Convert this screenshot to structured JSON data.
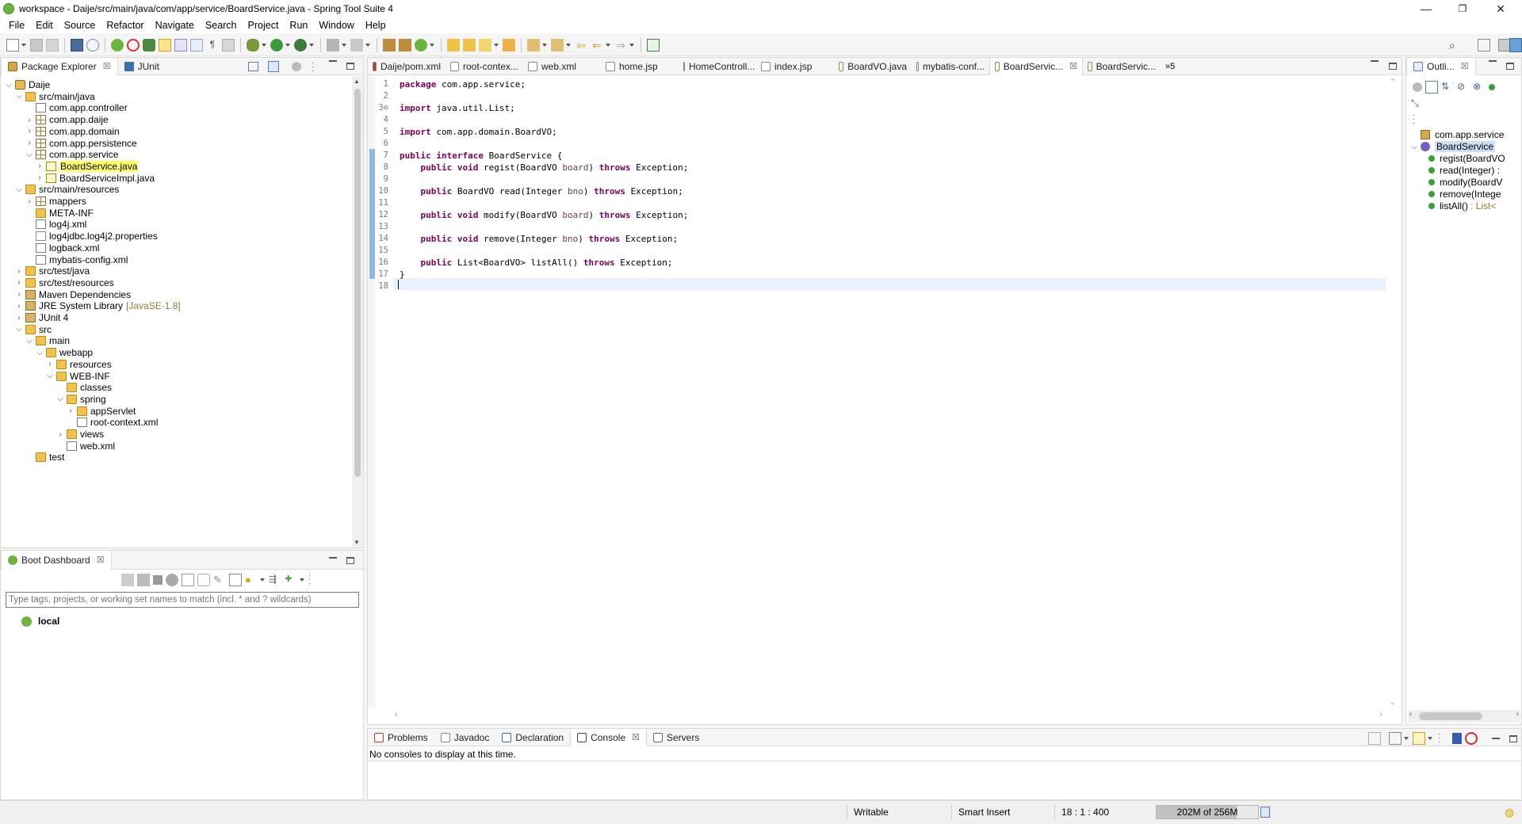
{
  "window": {
    "title": "workspace - Daije/src/main/java/com/app/service/BoardService.java - Spring Tool Suite 4",
    "minimize": "—",
    "restore": "❐",
    "close": "✕"
  },
  "menu": [
    "File",
    "Edit",
    "Source",
    "Refactor",
    "Navigate",
    "Search",
    "Project",
    "Run",
    "Window",
    "Help"
  ],
  "package_explorer": {
    "tabs": [
      {
        "label": "Package Explorer",
        "close": "☒"
      },
      {
        "label": "JUnit"
      }
    ],
    "tree": [
      {
        "label": "Daije",
        "level": 0,
        "twisty": "v",
        "icon": "project-icon"
      },
      {
        "label": "src/main/java",
        "level": 1,
        "twisty": "v",
        "icon": "source-folder-icon"
      },
      {
        "label": "com.app.controller",
        "level": 2,
        "twisty": "",
        "icon": "empty-package-icon"
      },
      {
        "label": "com.app.daije",
        "level": 2,
        "twisty": ">",
        "icon": "package-icon"
      },
      {
        "label": "com.app.domain",
        "level": 2,
        "twisty": ">",
        "icon": "package-icon"
      },
      {
        "label": "com.app.persistence",
        "level": 2,
        "twisty": ">",
        "icon": "package-icon"
      },
      {
        "label": "com.app.service",
        "level": 2,
        "twisty": "v",
        "icon": "package-icon"
      },
      {
        "label": "BoardService.java",
        "level": 3,
        "twisty": ">",
        "icon": "java-interface-file-icon",
        "selected": true
      },
      {
        "label": "BoardServiceImpl.java",
        "level": 3,
        "twisty": ">",
        "icon": "java-file-icon"
      },
      {
        "label": "src/main/resources",
        "level": 1,
        "twisty": "v",
        "icon": "source-folder-icon"
      },
      {
        "label": "mappers",
        "level": 2,
        "twisty": ">",
        "icon": "package-icon"
      },
      {
        "label": "META-INF",
        "level": 2,
        "twisty": "",
        "icon": "folder-icon"
      },
      {
        "label": "log4j.xml",
        "level": 2,
        "twisty": "",
        "icon": "xml-file-icon"
      },
      {
        "label": "log4jdbc.log4j2.properties",
        "level": 2,
        "twisty": "",
        "icon": "file-icon"
      },
      {
        "label": "logback.xml",
        "level": 2,
        "twisty": "",
        "icon": "xml-file-icon"
      },
      {
        "label": "mybatis-config.xml",
        "level": 2,
        "twisty": "",
        "icon": "xml-file-icon"
      },
      {
        "label": "src/test/java",
        "level": 1,
        "twisty": ">",
        "icon": "source-folder-icon"
      },
      {
        "label": "src/test/resources",
        "level": 1,
        "twisty": ">",
        "icon": "source-folder-icon"
      },
      {
        "label": "Maven Dependencies",
        "level": 1,
        "twisty": ">",
        "icon": "library-icon"
      },
      {
        "label": "JRE System Library",
        "deco": "[JavaSE-1.8]",
        "level": 1,
        "twisty": ">",
        "icon": "library-icon"
      },
      {
        "label": "JUnit 4",
        "level": 1,
        "twisty": ">",
        "icon": "library-icon"
      },
      {
        "label": "src",
        "level": 1,
        "twisty": "v",
        "icon": "folder-icon"
      },
      {
        "label": "main",
        "level": 2,
        "twisty": "v",
        "icon": "folder-icon"
      },
      {
        "label": "webapp",
        "level": 3,
        "twisty": "v",
        "icon": "folder-icon"
      },
      {
        "label": "resources",
        "level": 4,
        "twisty": ">",
        "icon": "folder-icon"
      },
      {
        "label": "WEB-INF",
        "level": 4,
        "twisty": "v",
        "icon": "folder-icon"
      },
      {
        "label": "classes",
        "level": 5,
        "twisty": "",
        "icon": "folder-icon"
      },
      {
        "label": "spring",
        "level": 5,
        "twisty": "v",
        "icon": "folder-icon"
      },
      {
        "label": "appServlet",
        "level": 6,
        "twisty": ">",
        "icon": "folder-icon"
      },
      {
        "label": "root-context.xml",
        "level": 6,
        "twisty": "",
        "icon": "xml-file-icon"
      },
      {
        "label": "views",
        "level": 5,
        "twisty": ">",
        "icon": "folder-icon"
      },
      {
        "label": "web.xml",
        "level": 5,
        "twisty": "",
        "icon": "xml-file-icon"
      },
      {
        "label": "test",
        "level": 2,
        "twisty": "",
        "icon": "folder-icon"
      }
    ]
  },
  "boot_dashboard": {
    "tab": "Boot Dashboard",
    "close": "☒",
    "filter_placeholder": "Type tags, projects, or working set names to match (incl. * and ? wildcards)",
    "items": [
      "local"
    ]
  },
  "editor": {
    "tabs": [
      {
        "label": "Daije/pom.xml",
        "icon": "maven-icon"
      },
      {
        "label": "root-contex...",
        "icon": "xml-file-icon"
      },
      {
        "label": "web.xml",
        "icon": "xml-file-icon"
      },
      {
        "label": "home.jsp",
        "icon": "jsp-file-icon"
      },
      {
        "label": "HomeControll...",
        "icon": "java-file-icon"
      },
      {
        "label": "index.jsp",
        "icon": "jsp-file-icon"
      },
      {
        "label": "BoardVO.java",
        "icon": "java-file-icon"
      },
      {
        "label": "mybatis-conf...",
        "icon": "xml-file-icon"
      },
      {
        "label": "BoardServic...",
        "icon": "java-interface-file-icon",
        "active": true
      },
      {
        "label": "BoardServic...",
        "icon": "java-file-icon"
      }
    ],
    "overflow": "»5",
    "line_numbers": [
      "1",
      "2",
      "3⊖",
      "4",
      "5",
      "6",
      "7",
      "8",
      "9",
      "10",
      "11",
      "12",
      "13",
      "14",
      "15",
      "16",
      "17",
      "18"
    ],
    "lines": [
      "package com.app.service;",
      "",
      "import java.util.List;",
      "",
      "import com.app.domain.BoardVO;",
      "",
      "public interface BoardService {",
      "    public void regist(BoardVO board) throws Exception;",
      "",
      "    public BoardVO read(Integer bno) throws Exception;",
      "",
      "    public void modify(BoardVO board) throws Exception;",
      "",
      "    public void remove(Integer bno) throws Exception;",
      "",
      "    public List<BoardVO> listAll() throws Exception;",
      "}",
      ""
    ]
  },
  "outline": {
    "tab": "Outli...",
    "close": "☒",
    "items": [
      {
        "label": "com.app.service",
        "level": 0,
        "icon": "import-icon"
      },
      {
        "label": "BoardService",
        "level": 0,
        "icon": "interface-icon",
        "twisty": "v",
        "selected": true
      },
      {
        "label": "regist(BoardVO",
        "level": 1,
        "icon": "public-method-icon"
      },
      {
        "label": "read(Integer) :",
        "level": 1,
        "icon": "public-method-icon"
      },
      {
        "label": "modify(BoardV",
        "level": 1,
        "icon": "public-method-icon"
      },
      {
        "label": "remove(Intege",
        "level": 1,
        "icon": "public-method-icon"
      },
      {
        "label": "listAll()",
        "type": ": List<",
        "level": 1,
        "icon": "public-method-icon"
      }
    ]
  },
  "bottom_panel": {
    "tabs": [
      {
        "label": "Problems",
        "icon": "problems-icon"
      },
      {
        "label": "Javadoc",
        "icon": "javadoc-icon"
      },
      {
        "label": "Declaration",
        "icon": "declaration-icon"
      },
      {
        "label": "Console",
        "icon": "console-icon",
        "active": true,
        "close": "☒"
      },
      {
        "label": "Servers",
        "icon": "servers-icon"
      }
    ],
    "console_message": "No consoles to display at this time."
  },
  "status_bar": {
    "writable": "Writable",
    "insert_mode": "Smart Insert",
    "cursor": "18 : 1 : 400",
    "heap": "202M of 256M",
    "heap_used_fraction": 0.79
  },
  "colors": {
    "accent_green": "#6db33f",
    "keyword": "#7f0055",
    "selection_yellow": "#ffff66",
    "current_line": "#e8f2fe"
  }
}
